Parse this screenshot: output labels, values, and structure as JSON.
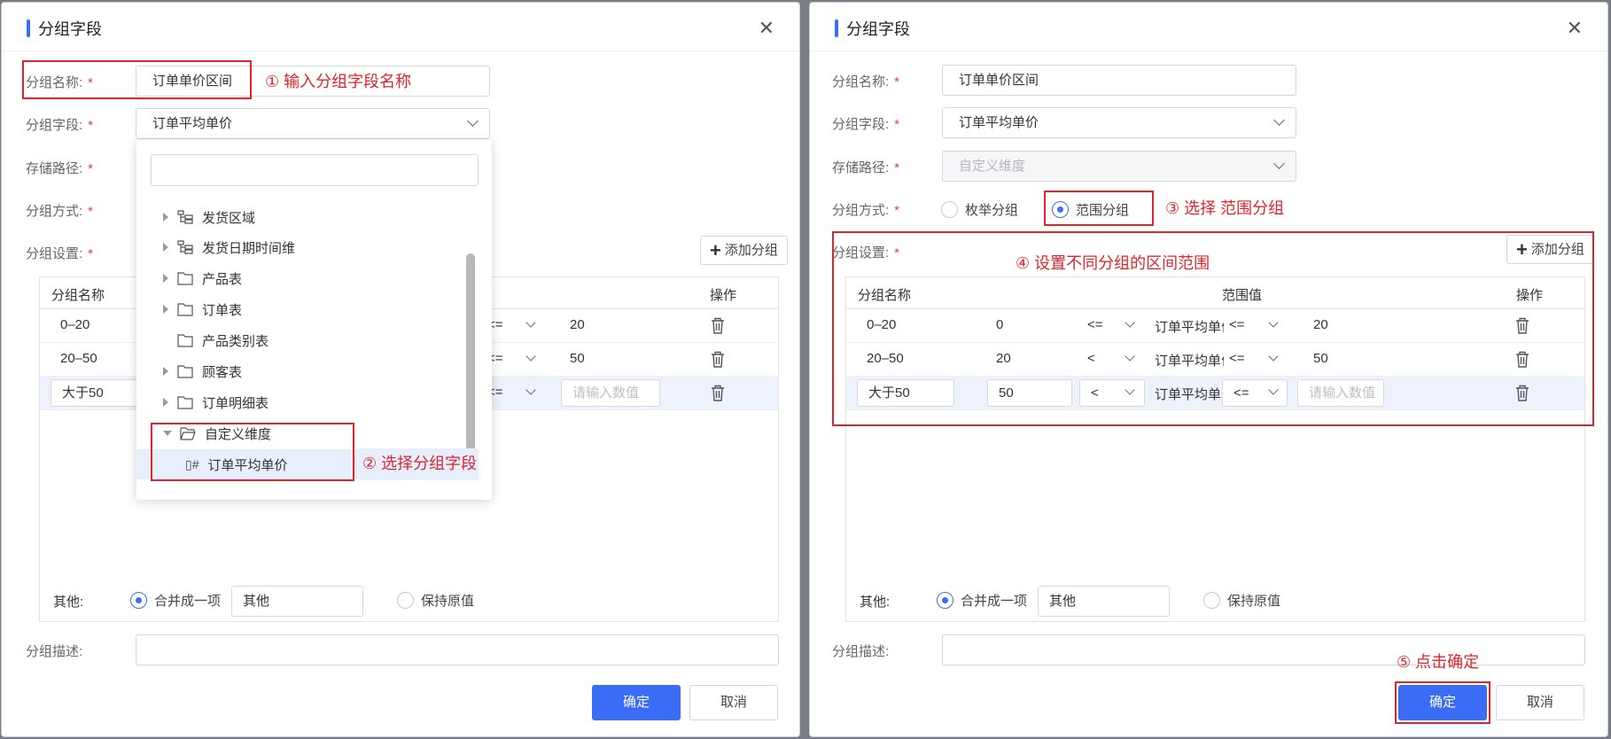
{
  "dialog": {
    "title": "分组字段"
  },
  "form": {
    "name_label": "分组名称:",
    "field_label": "分组字段:",
    "path_label": "存储路径:",
    "method_label": "分组方式:",
    "settings_label": "分组设置:",
    "desc_label": "分组描述:",
    "required": "*",
    "name_value": "订单单价区间",
    "field_value": "订单平均单价",
    "path_placeholder": "自定义维度",
    "method_options": [
      "枚举分组",
      "范围分组"
    ],
    "method_selected": "范围分组",
    "add_group": "添加分组"
  },
  "table": {
    "headers": {
      "name": "分组名称",
      "range": "范围值",
      "action": "操作"
    },
    "rows": [
      {
        "name": "0–20",
        "low": "0",
        "op1": "<=",
        "field": "订单平均单价",
        "op2": "<=",
        "high": "20"
      },
      {
        "name": "20–50",
        "low": "20",
        "op1": "<",
        "field": "订单平均单价",
        "op2": "<=",
        "high": "50"
      },
      {
        "name": "大于50",
        "low": "50",
        "op1": "<",
        "field": "订单平均单价",
        "op2": "<=",
        "high": "",
        "high_placeholder": "请输入数值"
      }
    ]
  },
  "other": {
    "label": "其他:",
    "merge": "合并成一项",
    "merge_value": "其他",
    "keep": "保持原值"
  },
  "buttons": {
    "ok": "确定",
    "cancel": "取消"
  },
  "dropdown": {
    "items": [
      "发货区域",
      "发货日期时间维",
      "产品表",
      "订单表",
      "产品类别表",
      "顾客表",
      "订单明细表",
      "自定义维度",
      "订单平均单价"
    ]
  },
  "annotations": {
    "a1": "① 输入分组字段名称",
    "a2": "② 选择分组字段",
    "a3": "③ 选择 范围分组",
    "a4": "④ 设置不同分组的区间范围",
    "a5": "⑤ 点击确定"
  },
  "colors": {
    "accent": "#3b6cf6",
    "annotation": "#e0242c"
  }
}
